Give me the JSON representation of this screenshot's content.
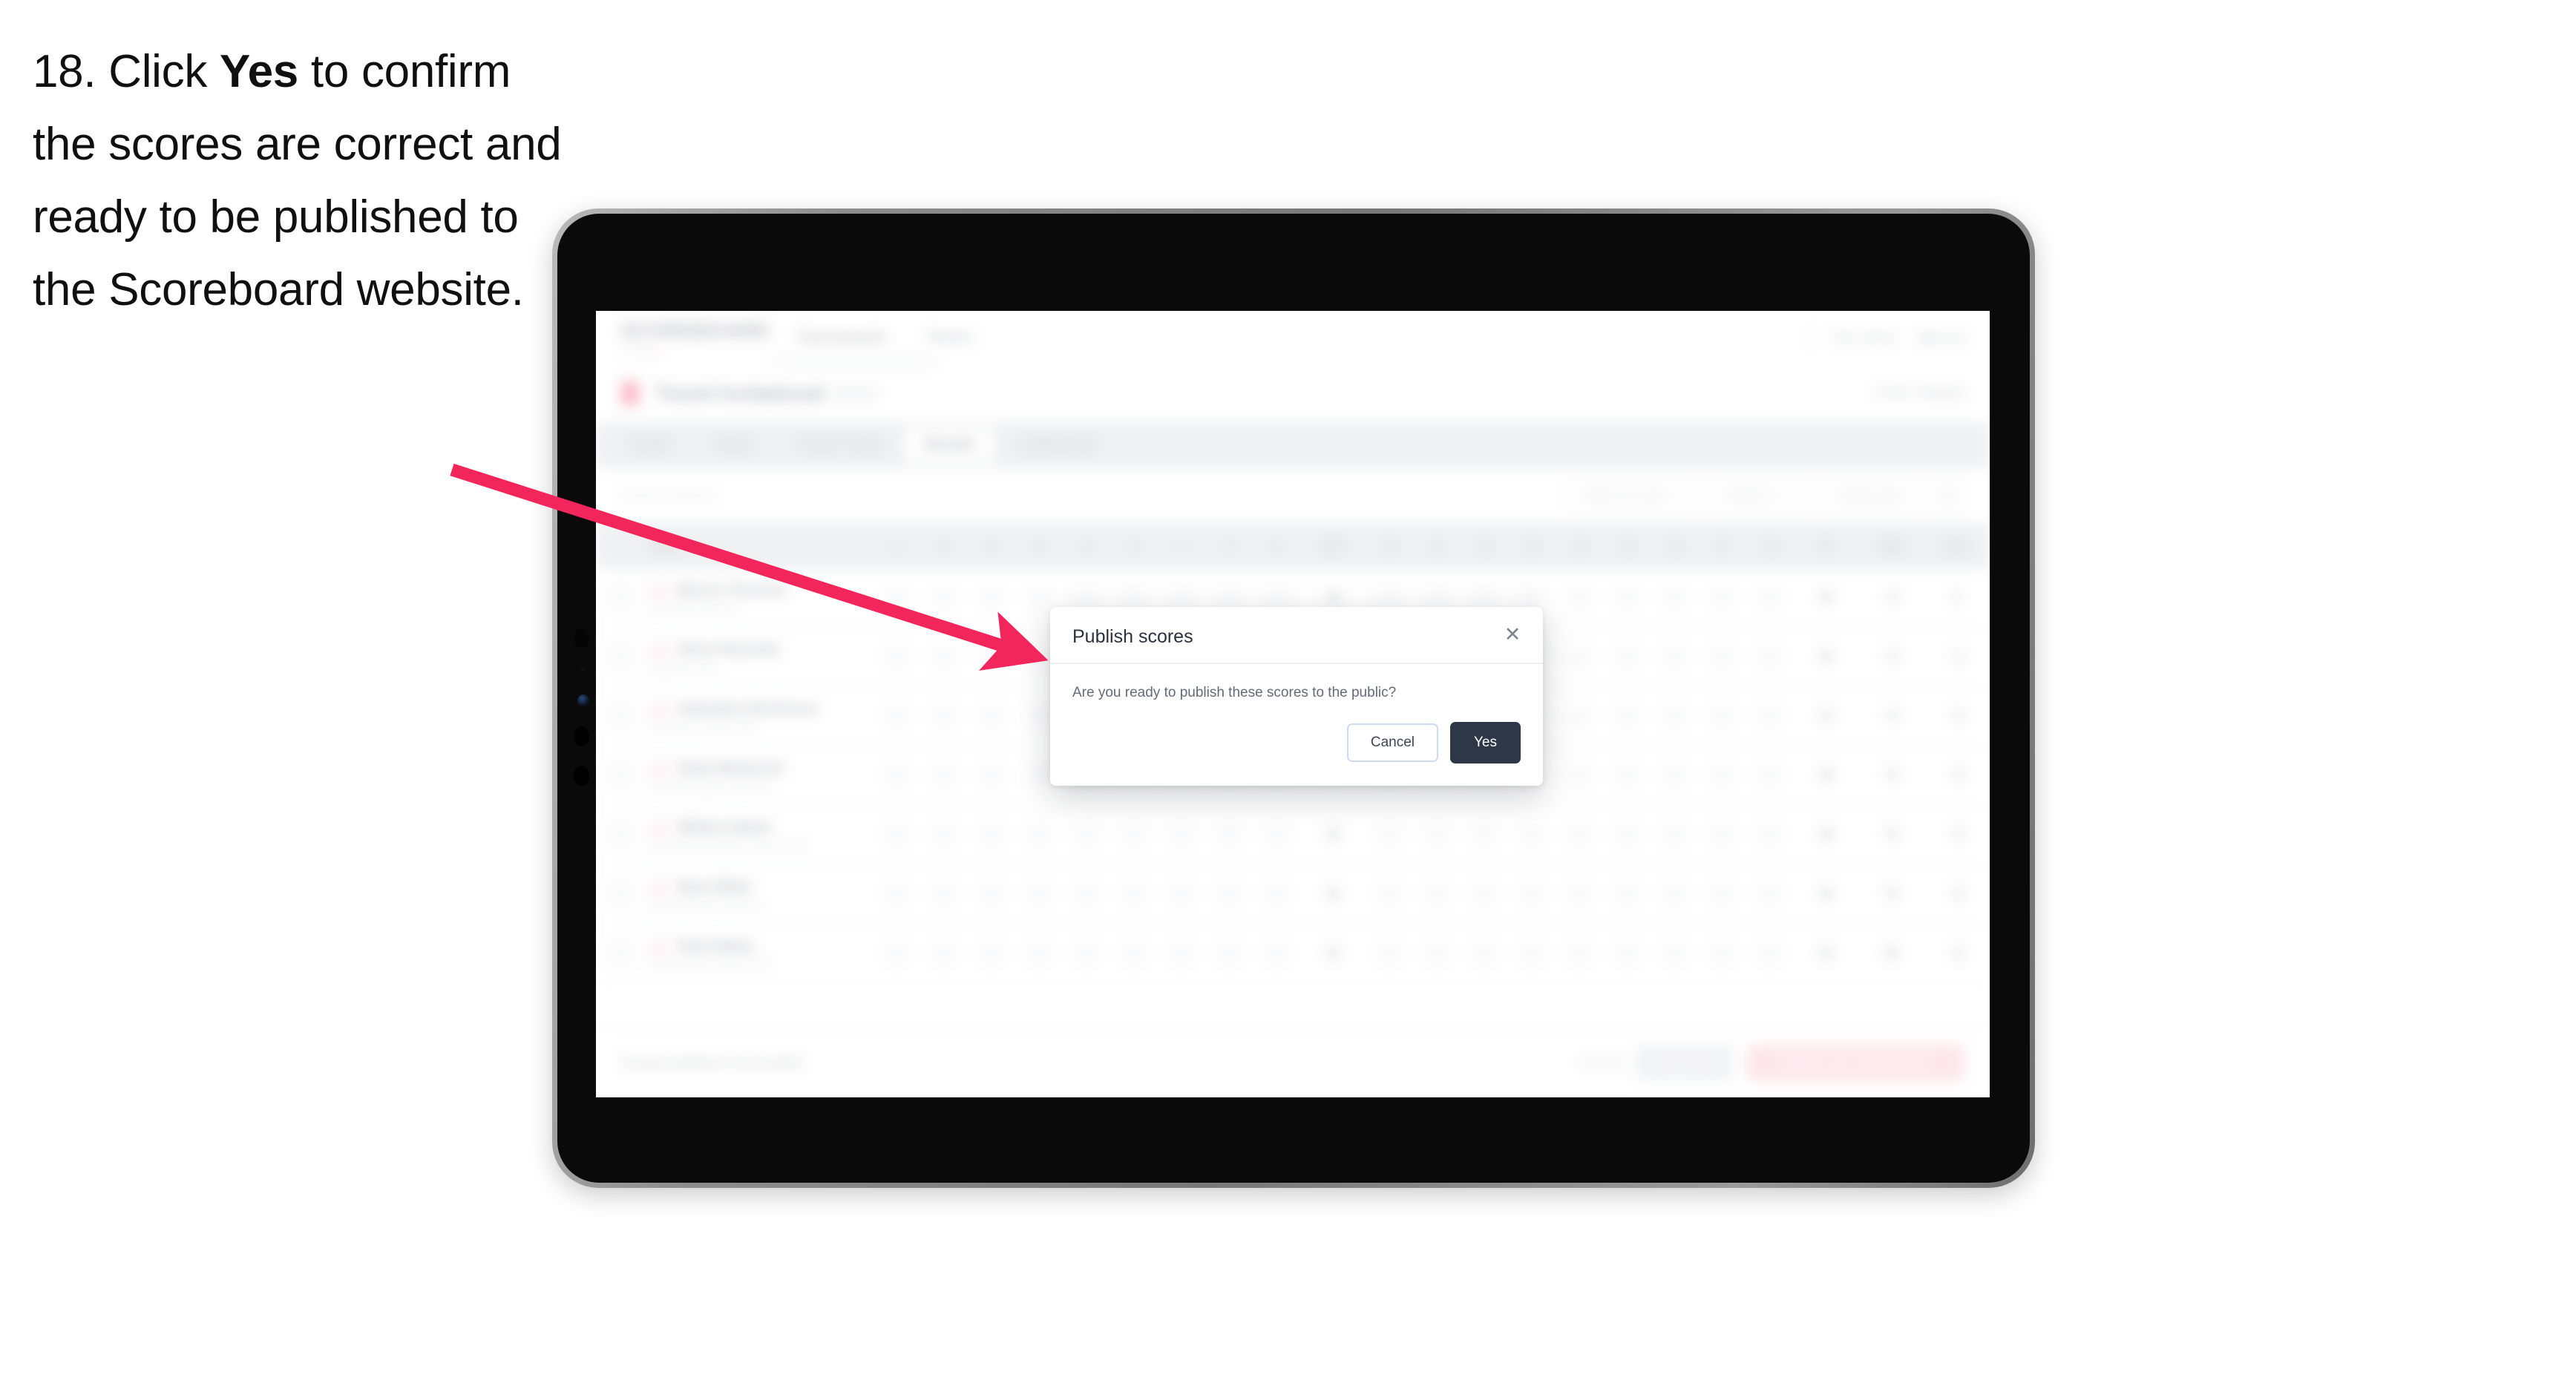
{
  "instruction": {
    "step_number": "18.",
    "text_before": " Click ",
    "emphasis": "Yes",
    "text_after": " to confirm the scores are correct and ready to be published to the Scoreboard website."
  },
  "colors": {
    "arrow": "#F2265B",
    "modal_primary_button": "#2D3748",
    "brand_accent": "#EF2F5E",
    "tabbar_background": "#D5D8DD",
    "device_bezel": "#0A0A0A",
    "device_frame": "#8D8D8D"
  },
  "device": {
    "type": "tablet",
    "orientation": "landscape"
  },
  "app": {
    "topnav": {
      "brand_title": "SCOREBOARD",
      "brand_subtitle": "ADMIN",
      "links": [
        "Tournaments",
        "Teams"
      ],
      "active_link": "Tournaments",
      "right_links": [
        "Tom Jones",
        "Sign out"
      ]
    },
    "page_header": {
      "title": "Travel Invitational",
      "subtitle": "2024",
      "action": "Event settings"
    },
    "tabs": [
      {
        "label": "Details",
        "selected": false
      },
      {
        "label": "Teams",
        "selected": false
      },
      {
        "label": "Course Setup",
        "selected": false
      },
      {
        "label": "Results",
        "selected": true
      },
      {
        "label": "Leaderboard",
        "selected": false
      }
    ],
    "filterbar": {
      "search_placeholder": "Search players",
      "controls": [
        {
          "label": "Filter by round"
        },
        {
          "label": "Round 1"
        },
        {
          "label": "Stroke play"
        }
      ],
      "icon_button": "settings-icon"
    },
    "table": {
      "headers": [
        "Player",
        "1",
        "2",
        "3",
        "4",
        "5",
        "6",
        "7",
        "8",
        "9",
        "OUT",
        "10",
        "11",
        "12",
        "13",
        "14",
        "15",
        "16",
        "17",
        "18",
        "IN",
        "Total",
        "Score"
      ],
      "rows": [
        {
          "player": "Marcus Thornton",
          "club": "Riverside Golf Club",
          "holes": [
            "4",
            "5",
            "3",
            "4",
            "4",
            "5",
            "3",
            "4",
            "4"
          ],
          "out": "36",
          "holes_in": [
            "4",
            "3",
            "5",
            "4",
            "4",
            "3",
            "5",
            "4",
            "4"
          ],
          "in": "36",
          "total": "72",
          "score": "E"
        },
        {
          "player": "Oliver Reynolds",
          "club": "Highland Links",
          "holes": [
            "5",
            "4",
            "3",
            "4",
            "5",
            "4",
            "3",
            "5",
            "4"
          ],
          "out": "37",
          "holes_in": [
            "4",
            "4",
            "5",
            "3",
            "4",
            "4",
            "5",
            "4",
            "3"
          ],
          "in": "36",
          "total": "73",
          "score": "+1"
        },
        {
          "player": "Sebastian Hutchinson",
          "club": "Pinehurst Country Club",
          "holes": [
            "4",
            "4",
            "4",
            "3",
            "5",
            "4",
            "4",
            "4",
            "5"
          ],
          "out": "37",
          "holes_in": [
            "5",
            "4",
            "4",
            "4",
            "3",
            "5",
            "4",
            "4",
            "4"
          ],
          "in": "37",
          "total": "74",
          "score": "+2"
        },
        {
          "player": "Dylan Mackenzie",
          "club": "Fairway Heights Golf Club",
          "holes": [
            "4",
            "5",
            "4",
            "4",
            "4",
            "3",
            "5",
            "4",
            "4"
          ],
          "out": "37",
          "holes_in": [
            "4",
            "5",
            "3",
            "4",
            "5",
            "4",
            "4",
            "4",
            "5"
          ],
          "in": "38",
          "total": "75",
          "score": "+3"
        },
        {
          "player": "William Abbott",
          "club": "Blackwood Golf and Country Club",
          "holes": [
            "5",
            "4",
            "4",
            "5",
            "4",
            "4",
            "3",
            "5",
            "4"
          ],
          "out": "38",
          "holes_in": [
            "4",
            "4",
            "5",
            "4",
            "4",
            "5",
            "3",
            "4",
            "5"
          ],
          "in": "38",
          "total": "76",
          "score": "+4"
        },
        {
          "player": "Ryan Webb",
          "club": "Meadowbrook Golf Club",
          "holes": [
            "4",
            "5",
            "5",
            "4",
            "4",
            "4",
            "5",
            "4",
            "4"
          ],
          "out": "39",
          "holes_in": [
            "5",
            "4",
            "4",
            "5",
            "4",
            "4",
            "4",
            "5",
            "4"
          ],
          "in": "39",
          "total": "78",
          "score": "+6"
        },
        {
          "player": "Noah Bailey",
          "club": "Stonebridge Country Club",
          "holes": [
            "5",
            "5",
            "4",
            "4",
            "5",
            "4",
            "4",
            "5",
            "4"
          ],
          "out": "40",
          "holes_in": [
            "4",
            "5",
            "5",
            "4",
            "4",
            "5",
            "4",
            "4",
            "5"
          ],
          "in": "40",
          "total": "80",
          "score": "+8"
        }
      ]
    },
    "bottombar": {
      "note": "Results published successfully",
      "text_action": "Cancel",
      "secondary_button": "Save all",
      "primary_button": "Publish and notify players"
    }
  },
  "modal": {
    "title": "Publish scores",
    "message": "Are you ready to publish these scores to the public?",
    "close_icon": "close-icon",
    "cancel_label": "Cancel",
    "confirm_label": "Yes"
  }
}
